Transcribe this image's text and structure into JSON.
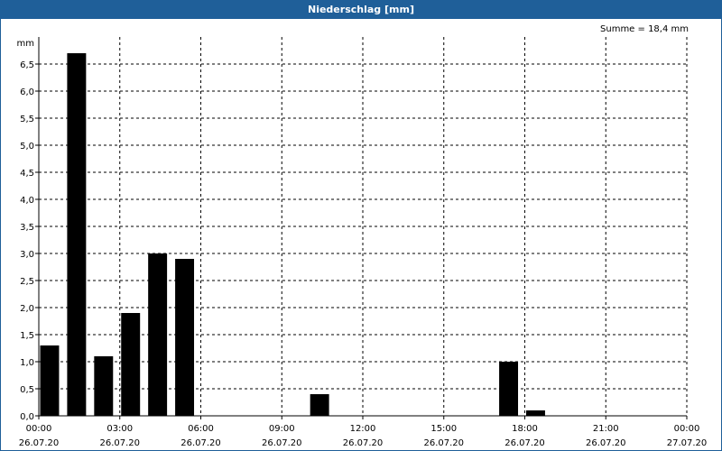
{
  "window": {
    "title": "Niederschlag [mm]"
  },
  "summary": {
    "text": "Summe = 18,4 mm"
  },
  "chart_data": {
    "type": "bar",
    "ylabel": "mm",
    "ylim": [
      0,
      7
    ],
    "yticks": [
      {
        "value": 0.0,
        "label": "0,0"
      },
      {
        "value": 0.5,
        "label": "0,5"
      },
      {
        "value": 1.0,
        "label": "1,0"
      },
      {
        "value": 1.5,
        "label": "1,5"
      },
      {
        "value": 2.0,
        "label": "2,0"
      },
      {
        "value": 2.5,
        "label": "2,5"
      },
      {
        "value": 3.0,
        "label": "3,0"
      },
      {
        "value": 3.5,
        "label": "3,5"
      },
      {
        "value": 4.0,
        "label": "4,0"
      },
      {
        "value": 4.5,
        "label": "4,5"
      },
      {
        "value": 5.0,
        "label": "5,0"
      },
      {
        "value": 5.5,
        "label": "5,5"
      },
      {
        "value": 6.0,
        "label": "6,0"
      },
      {
        "value": 6.5,
        "label": "6,5"
      }
    ],
    "xlim_hours": [
      0,
      24
    ],
    "xticks": [
      {
        "hour": 0,
        "time": "00:00",
        "date": "26.07.20"
      },
      {
        "hour": 3,
        "time": "03:00",
        "date": "26.07.20"
      },
      {
        "hour": 6,
        "time": "06:00",
        "date": "26.07.20"
      },
      {
        "hour": 9,
        "time": "09:00",
        "date": "26.07.20"
      },
      {
        "hour": 12,
        "time": "12:00",
        "date": "26.07.20"
      },
      {
        "hour": 15,
        "time": "15:00",
        "date": "26.07.20"
      },
      {
        "hour": 18,
        "time": "18:00",
        "date": "26.07.20"
      },
      {
        "hour": 21,
        "time": "21:00",
        "date": "26.07.20"
      },
      {
        "hour": 24,
        "time": "00:00",
        "date": "27.07.20"
      }
    ],
    "bars": [
      {
        "hour": 0,
        "value": 1.3
      },
      {
        "hour": 1,
        "value": 6.7
      },
      {
        "hour": 2,
        "value": 1.1
      },
      {
        "hour": 3,
        "value": 1.9
      },
      {
        "hour": 4,
        "value": 3.0
      },
      {
        "hour": 5,
        "value": 2.9
      },
      {
        "hour": 10,
        "value": 0.4
      },
      {
        "hour": 17,
        "value": 1.0
      },
      {
        "hour": 18,
        "value": 0.1
      }
    ],
    "grid": true,
    "bar_color": "#000000"
  }
}
